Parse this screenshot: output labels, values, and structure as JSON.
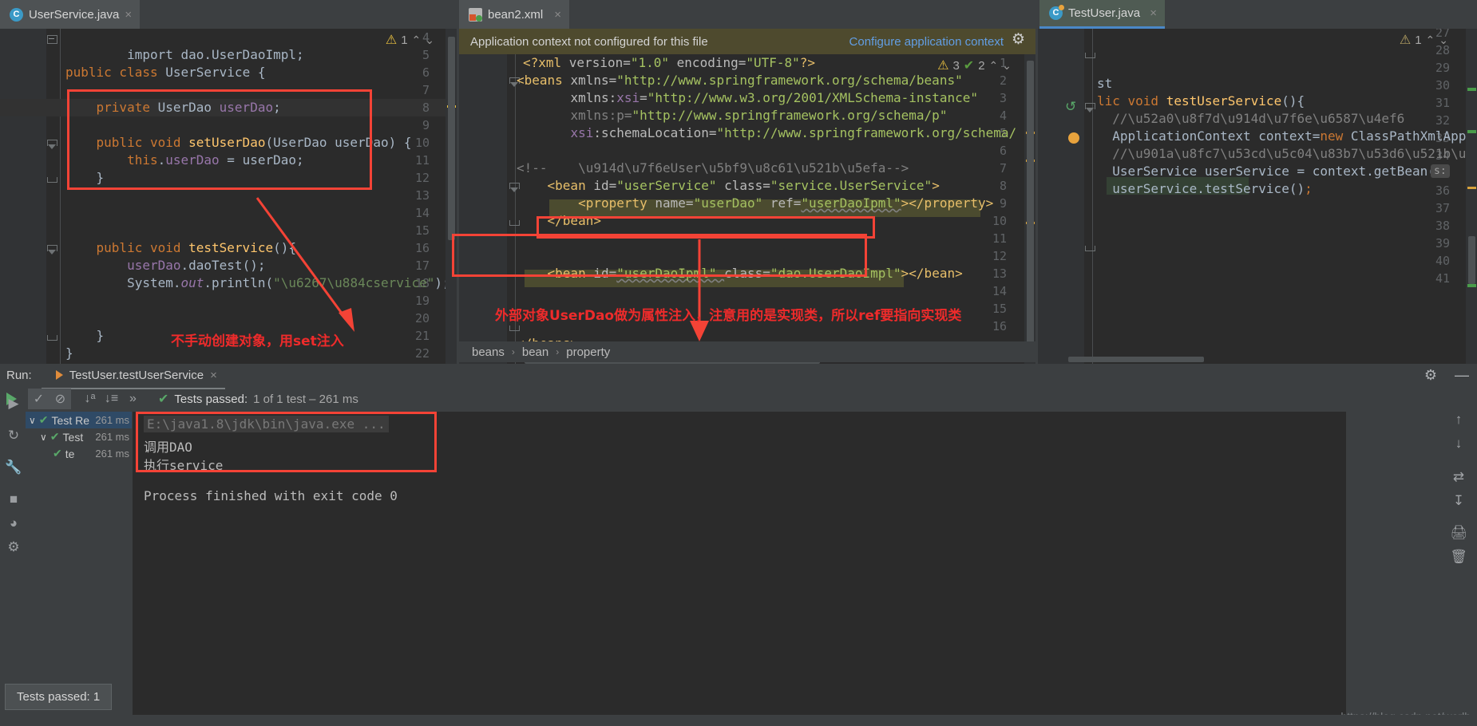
{
  "tabs": [
    {
      "name": "UserService.java",
      "icon": "java-class-icon",
      "close": "×"
    },
    {
      "name": "bean2.xml",
      "icon": "xml-file-icon",
      "close": "×"
    },
    {
      "name": "TestUser.java",
      "icon": "java-class-run-icon",
      "close": "×"
    }
  ],
  "left_editor": {
    "line_numbers": [
      "4",
      "5",
      "6",
      "7",
      "8",
      "9",
      "10",
      "11",
      "12",
      "13",
      "14",
      "15",
      "16",
      "17",
      "18",
      "19",
      "20",
      "21",
      "22"
    ],
    "inspection": {
      "warn_count": "1",
      "warn_icon": "⚠",
      "up": "⌃",
      "down": "⌄"
    },
    "code_lines": [
      "import dao.UserDaoImpl;",
      "",
      "public class UserService {",
      "",
      "    private UserDao userDao;",
      "",
      "    public void setUserDao(UserDao userDao) {",
      "        this.userDao = userDao;",
      "    }",
      "",
      "",
      "",
      "    public void testService(){",
      "        userDao.daoTest();",
      "        System.out.println(\"执行service\");",
      "",
      "    }",
      "}",
      ""
    ],
    "annotation": "不手动创建对象，用set注入"
  },
  "mid_editor": {
    "banner": {
      "message": "Application context not configured for this file",
      "action": "Configure application context",
      "gear_icon": "gear-icon"
    },
    "inspection": {
      "warn_icon": "⚠",
      "warn_count": "3",
      "ok_icon": "✔",
      "ok_count": "2",
      "up": "⌃",
      "down": "⌄"
    },
    "line_numbers": [
      "1",
      "2",
      "3",
      "4",
      "5",
      "6",
      "7",
      "8",
      "9",
      "10",
      "11",
      "12",
      "13",
      "14",
      "15",
      "16"
    ],
    "code_lines": [
      "<?xml version=\"1.0\" encoding=\"UTF-8\"?>",
      "<beans xmlns=\"http://www.springframework.org/schema/beans\"",
      "       xmlns:xsi=\"http://www.w3.org/2001/XMLSchema-instance\"",
      "       xmlns:p=\"http://www.springframework.org/schema/p\"",
      "       xsi:schemaLocation=\"http://www.springframework.org/schema/",
      "",
      "<!--    配置User对象创建-->",
      "    <bean id=\"userService\" class=\"service.UserService\">",
      "        <property name=\"userDao\" ref=\"userDaoIpml\"></property>",
      "    </bean>",
      "",
      "    <bean id=\"userDaoIpml\" class=\"dao.UserDaoImpl\"></bean>",
      "",
      "",
      "",
      "</beans>"
    ],
    "annotation": "外部对象UserDao做为属性注入，注意用的是实现类，所以ref要指向实现类",
    "breadcrumbs": [
      "beans",
      "bean",
      "property"
    ],
    "breadcrumb_sep": "›"
  },
  "right_editor": {
    "line_numbers": [
      "27",
      "28",
      "29",
      "30",
      "31",
      "32",
      "33",
      "34",
      "35",
      "36",
      "37",
      "38",
      "39",
      "40",
      "41"
    ],
    "inspection": {
      "warn_icon": "⚠",
      "warn_count": "1",
      "up": "⌃",
      "down": "⌄"
    },
    "code_lines": [
      "",
      "",
      "",
      "st",
      "lic void testUserService(){",
      "    //加载配置文件",
      "    ApplicationContext context=new ClassPathXmlApp",
      "    //通过反射获取创建的对象",
      "    UserService userService = context.getBean( s: \"",
      "    userService.testService();",
      "",
      "",
      "",
      "",
      ""
    ],
    "param_hint": "s:",
    "run_gutter_icon": "run-test-icon",
    "bulb_icon": "intention-bulb-icon"
  },
  "run_panel": {
    "label": "Run:",
    "tab_title": "TestUser.testUserService",
    "tab_close": "×",
    "header_icons": {
      "settings": "gear-icon",
      "minimize": "—"
    },
    "toolbar": {
      "rerun": "rerun-icon",
      "toggle_passed": "show-passed-icon",
      "ignore": "ignore-icon",
      "sort_alpha": "sort-alphabetically-icon",
      "sort_duration": "sort-by-duration-icon",
      "more": "»"
    },
    "status": {
      "icon": "✔",
      "label": "Tests passed:",
      "detail": "1 of 1 test – 261 ms"
    },
    "tree": [
      {
        "label": "Test Re",
        "time": "261 ms",
        "icon": "✔",
        "chevron": "∨",
        "indent": 0,
        "selected": true
      },
      {
        "label": "Test",
        "time": "261 ms",
        "icon": "✔",
        "chevron": "∨",
        "indent": 1,
        "selected": false
      },
      {
        "label": "te",
        "time": "261 ms",
        "icon": "✔",
        "chevron": "",
        "indent": 2,
        "selected": false
      }
    ],
    "console": [
      "E:\\java1.8\\jdk\\bin\\java.exe ...",
      "调用DAO",
      "执行service",
      "",
      "Process finished with exit code 0"
    ],
    "left_tools": [
      "debug-icon",
      "restart-icon",
      "wrench-icon",
      "stop-icon",
      "camera-icon",
      "profiler-icon"
    ],
    "right_tools": [
      "scroll-up-icon",
      "scroll-down-icon",
      "soft-wrap-icon",
      "scroll-end-icon",
      "print-icon",
      "trash-icon"
    ],
    "tooltip_badge": "Tests passed: 1"
  },
  "watermark": "https://blog.csdn.net/worlb",
  "colors": {
    "accent_red": "#f44336",
    "link_blue": "#629ee4",
    "pass_green": "#59a869",
    "warn_yellow": "#e8bf3f",
    "editor_bg": "#2b2b2b",
    "panel_bg": "#3c3f41"
  }
}
